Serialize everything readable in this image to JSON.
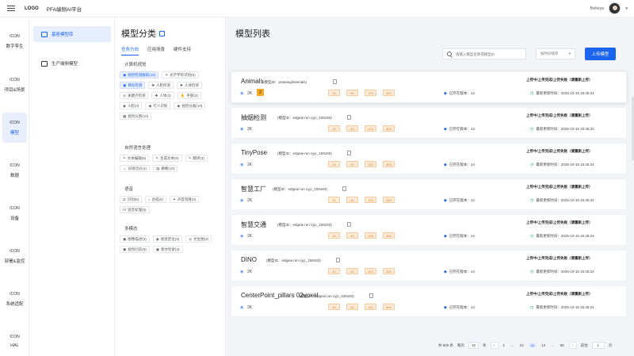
{
  "topbar": {
    "logo": "LOGO",
    "platform": "PFA端侧AI平台",
    "user_name": "Beileye",
    "user_caret": "▾"
  },
  "rail": [
    {
      "icon": "ICON",
      "label": "数字孪生",
      "active": false
    },
    {
      "icon": "ICON",
      "label": "项目&场景",
      "active": false
    },
    {
      "icon": "ICON",
      "label": "模型",
      "active": true
    },
    {
      "icon": "ICON",
      "label": "数据",
      "active": false
    },
    {
      "icon": "ICON",
      "label": "设备",
      "active": false
    },
    {
      "icon": "ICON",
      "label": "部署&监控",
      "active": false
    },
    {
      "icon": "ICON",
      "label": "系统适配",
      "active": false
    },
    {
      "icon": "ICON",
      "label": "HAL",
      "active": false
    }
  ],
  "subnav": [
    {
      "label": "基座模型库",
      "icon": "model-library-icon",
      "active": true
    },
    {
      "label": "生产端侧模型",
      "icon": "production-model-icon",
      "active": false
    }
  ],
  "categories": {
    "title": "模型分类",
    "tabs": [
      {
        "label": "任务方向",
        "active": true
      },
      {
        "label": "应用场景",
        "active": false
      },
      {
        "label": "硬件支持",
        "active": false
      }
    ],
    "groups": [
      {
        "title": "计算机视觉",
        "chips": [
          {
            "icon": "▣",
            "label": "视觉检测跟踪(15)",
            "sel": true
          },
          {
            "icon": "✕",
            "label": "光学字符识别(5)",
            "sel": false
          },
          {
            "icon": "▣",
            "label": "目标检测",
            "sel": true
          },
          {
            "icon": "✚",
            "label": "人脸检测",
            "sel": false
          },
          {
            "icon": "✚",
            "label": "人体检测",
            "sel": false
          },
          {
            "icon": "◎",
            "label": "关键点检测",
            "sel": false
          },
          {
            "icon": "✚",
            "label": "人体(3)",
            "sel": false
          },
          {
            "icon": "✋",
            "label": "手部(3)",
            "sel": false
          },
          {
            "icon": "◉",
            "label": "人脸(3)",
            "sel": false
          },
          {
            "icon": "◉",
            "label": "行人识别",
            "sel": false
          },
          {
            "icon": "◉",
            "label": "视觉分类(10)",
            "sel": false
          },
          {
            "icon": "▦",
            "label": "视觉分割(10)",
            "sel": false
          }
        ]
      },
      {
        "title": "自然语言处理",
        "chips": [
          {
            "icon": "✎",
            "label": "文本编辑(5)",
            "sel": false
          },
          {
            "icon": "✎",
            "label": "生成文本(5)",
            "sel": false
          },
          {
            "icon": "✎",
            "label": "翻译(3)",
            "sel": false
          },
          {
            "icon": "↔",
            "label": "词语切分(4)",
            "sel": false
          },
          {
            "icon": "▤",
            "label": "摘要(10)",
            "sel": false
          }
        ]
      },
      {
        "title": "语音",
        "chips": [
          {
            "icon": "⇄",
            "label": "识别(5)",
            "sel": false
          },
          {
            "icon": "♪",
            "label": "合成(5)",
            "sel": false
          },
          {
            "icon": "✦",
            "label": "声音克隆(3)",
            "sel": false
          },
          {
            "icon": "☊",
            "label": "语音处理(5)",
            "sel": false
          }
        ]
      },
      {
        "title": "多模态",
        "chips": [
          {
            "icon": "▣",
            "label": "图像描述(3)",
            "sel": false
          },
          {
            "icon": "◉",
            "label": "视觉定位(3)",
            "sel": false
          },
          {
            "icon": "◎",
            "label": "文生图(3)",
            "sel": false
          },
          {
            "icon": "▣",
            "label": "视觉问答(5)",
            "sel": false
          },
          {
            "icon": "▣",
            "label": "图文检索(3)",
            "sel": false
          }
        ]
      }
    ]
  },
  "main": {
    "title": "模型列表",
    "search_placeholder": "请输入模型名称或模型ID",
    "sort_label": "按时间排序",
    "sort_caret": "▾",
    "upload_label": "上传模型"
  },
  "models": [
    {
      "name": "Animals",
      "id": "(模型ID：prasangi/animals)",
      "views": "2K",
      "badge": "2",
      "tags": [
        "10",
        "40",
        "120",
        "300"
      ],
      "versions": "已存在版本：14",
      "status": "上传中/上传完成/上传失败（请重新上传）",
      "updated": "最新更新时间：2025-10-15 15:45:24"
    },
    {
      "name": "抽烟检测",
      "id": "(模型ID：edgeai run cyjc_159183)",
      "views": "2K",
      "badge": "",
      "tags": [
        "10",
        "40",
        "120",
        "300"
      ],
      "versions": "已存在版本：14",
      "status": "上传中/上传完成/上传失败（请重新上传）",
      "updated": "最新更新时间：2025-10-15 15:45:24"
    },
    {
      "name": "TinyPose",
      "id": "(模型ID：edgeai run cyjc_159183)",
      "views": "2K",
      "badge": "",
      "tags": [
        "10",
        "40",
        "120",
        "300"
      ],
      "versions": "已存在版本：14",
      "status": "上传中/上传完成/上传失败（请重新上传）",
      "updated": "最新更新时间：2025-10-15 15:45:24"
    },
    {
      "name": "智慧工厂",
      "id": "(模型ID：edgeai run cyjc_159183)",
      "views": "2K",
      "badge": "",
      "tags": [
        "10",
        "40",
        "120",
        "300"
      ],
      "versions": "已存在版本：14",
      "status": "上传中/上传完成/上传失败（请重新上传）",
      "updated": "最新更新时间：2025-10-15 15:45:24"
    },
    {
      "name": "智慧交通",
      "id": "(模型ID：edgeai run cyjc_159183)",
      "views": "2K",
      "badge": "",
      "tags": [
        "10",
        "40",
        "120",
        "300"
      ],
      "versions": "已存在版本：14",
      "status": "上传中/上传完成/上传失败（请重新上传）",
      "updated": "最新更新时间：2025-10-15 15:45:24"
    },
    {
      "name": "DINO",
      "id": "(模型ID：edgeai run cyjc_159183)",
      "views": "2K",
      "badge": "",
      "tags": [
        "10",
        "40",
        "120",
        "300"
      ],
      "versions": "已存在版本：14",
      "status": "上传中/上传完成/上传失败（请重新上传）",
      "updated": "最新更新时间：2025-10-15 15:45:24"
    },
    {
      "name": "CenterPoint_pillars 02voxel",
      "id": "(模型ID：edgeai run cyjc_159183)",
      "views": "2K",
      "badge": "",
      "tags": [
        "10",
        "40",
        "120",
        "300"
      ],
      "versions": "已存在版本：14",
      "status": "上传中/上传完成/上传失败（请重新上传）",
      "updated": "最新更新时间：2025-10-15 15:45:24"
    }
  ],
  "pagination": {
    "total": "共 800 条",
    "per_page_label": "每页",
    "per_page": "10",
    "per_page_unit": "条",
    "prev": "‹",
    "pages": [
      "1",
      "…",
      "10",
      "11",
      "12",
      "…",
      "50"
    ],
    "current": "11",
    "next": "›",
    "goto_label": "前往",
    "goto_value": "1",
    "goto_unit": "页"
  }
}
